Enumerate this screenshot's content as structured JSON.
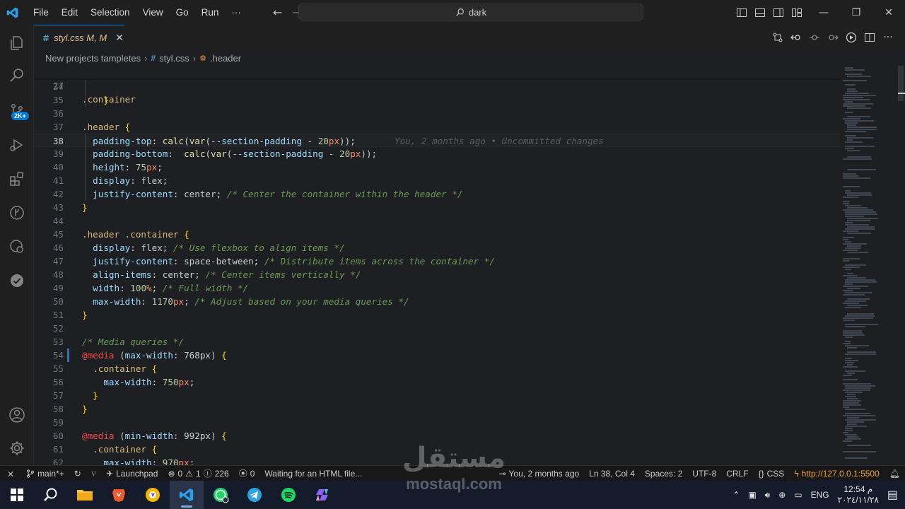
{
  "window": {
    "menu": [
      "File",
      "Edit",
      "Selection",
      "View",
      "Go",
      "Run",
      "···"
    ],
    "search": "dark"
  },
  "activity": {
    "badge": "2K+"
  },
  "tab": {
    "label": "styl.css M, M",
    "icon": "#"
  },
  "breadcrumb": [
    "New projects tampletes",
    "styl.css",
    ".header"
  ],
  "sticky": {
    "num": "27",
    "text": ".container"
  },
  "blame": "You, 2 months ago • Uncommitted changes",
  "lines": [
    {
      "n": "34"
    },
    {
      "n": "35",
      "t": "    }"
    },
    {
      "n": "36"
    },
    {
      "n": "37",
      "t": ".header {"
    },
    {
      "n": "38",
      "t": "  padding-top: calc(var(--section-padding - 20px));"
    },
    {
      "n": "39",
      "t": "  padding-bottom:  calc(var(--section-padding - 20px));"
    },
    {
      "n": "40",
      "t": "  height: 75px;"
    },
    {
      "n": "41",
      "t": "  display: flex;"
    },
    {
      "n": "42",
      "t": "  justify-content: center; /* Center the container within the header */"
    },
    {
      "n": "43",
      "t": "}"
    },
    {
      "n": "44"
    },
    {
      "n": "45",
      "t": ".header .container {"
    },
    {
      "n": "46",
      "t": "  display: flex; /* Use flexbox to align items */"
    },
    {
      "n": "47",
      "t": "  justify-content: space-between; /* Distribute items across the container */"
    },
    {
      "n": "48",
      "t": "  align-items: center; /* Center items vertically */"
    },
    {
      "n": "49",
      "t": "  width: 100%; /* Full width */"
    },
    {
      "n": "50",
      "t": "  max-width: 1170px; /* Adjust based on your media queries */"
    },
    {
      "n": "51",
      "t": "}"
    },
    {
      "n": "52"
    },
    {
      "n": "53",
      "t": "/* Media queries */"
    },
    {
      "n": "54",
      "t": "@media (max-width: 768px) {"
    },
    {
      "n": "55",
      "t": "  .container {"
    },
    {
      "n": "56",
      "t": "    max-width: 750px;"
    },
    {
      "n": "57",
      "t": "  }"
    },
    {
      "n": "58",
      "t": "}"
    },
    {
      "n": "59"
    },
    {
      "n": "60",
      "t": "@media (min-width: 992px) {"
    },
    {
      "n": "61",
      "t": "  .container {"
    },
    {
      "n": "62",
      "t": "    max-width: 970px;"
    }
  ],
  "status": {
    "branch": "main*+",
    "launchpad": "Launchpad",
    "errors": "0",
    "warnings": "1",
    "info": "226",
    "ports": "0",
    "message": "Waiting for an HTML file...",
    "blame": "You, 2 months ago",
    "position": "Ln 38, Col 4",
    "spaces": "Spaces: 2",
    "encoding": "UTF-8",
    "eol": "CRLF",
    "language": "CSS",
    "live": "http://127.0.0.1:5500"
  },
  "taskbar": {
    "lang": "ENG",
    "time": "12:54 م",
    "date": "٢٠٢٤/١١/٢٨"
  },
  "watermark": {
    "arabic": "مستقل",
    "latin": "mostaql.com"
  },
  "colors": {
    "accent": "#0078d4",
    "selector": "#d7ba7d",
    "property": "#9cdcfe",
    "comment": "#6a9955"
  }
}
